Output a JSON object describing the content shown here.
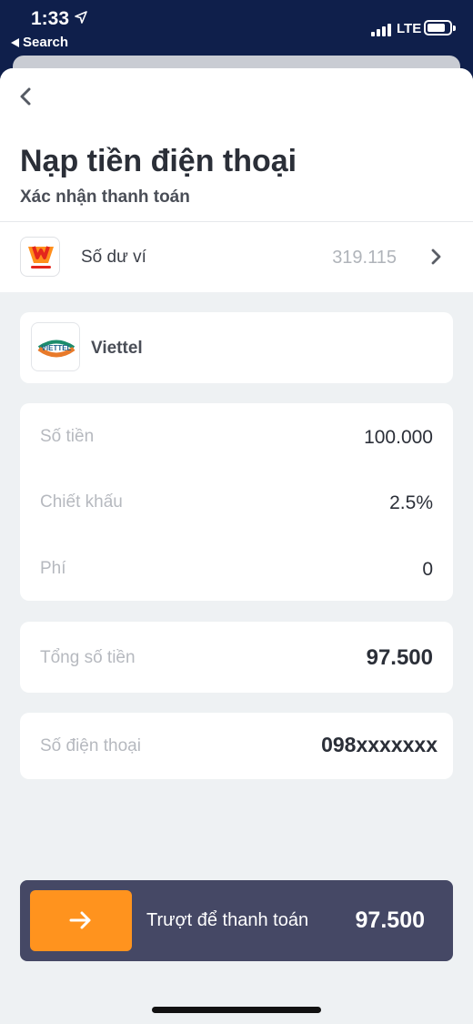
{
  "status_bar": {
    "time": "1:33",
    "back_app_label": "Search",
    "network": "LTE"
  },
  "header": {
    "title": "Nạp tiền điện thoại",
    "subtitle": "Xác nhận thanh toán"
  },
  "wallet": {
    "label": "Số dư ví",
    "balance": "319.115"
  },
  "provider": {
    "name": "Viettel",
    "logo_text": "VIETTEL"
  },
  "details": [
    {
      "label": "Số tiền",
      "value": "100.000"
    },
    {
      "label": "Chiết khấu",
      "value": "2.5%"
    },
    {
      "label": "Phí",
      "value": "0"
    }
  ],
  "total": {
    "label": "Tổng số tiền",
    "value": "97.500"
  },
  "phone": {
    "label": "Số điện thoại",
    "value": "098xxxxxxx"
  },
  "slider": {
    "label": "Trượt để thanh toán",
    "amount": "97.500"
  },
  "colors": {
    "accent_orange": "#ff931e",
    "slider_bg": "#454865",
    "status_bar_bg": "#0f1f4b",
    "page_bg": "#eef1f3"
  },
  "icons": [
    "location-arrow-icon",
    "signal-icon",
    "battery-icon",
    "back-chevron-icon",
    "trumoney-logo",
    "chevron-right-icon",
    "viettel-logo",
    "arrow-right-icon"
  ]
}
